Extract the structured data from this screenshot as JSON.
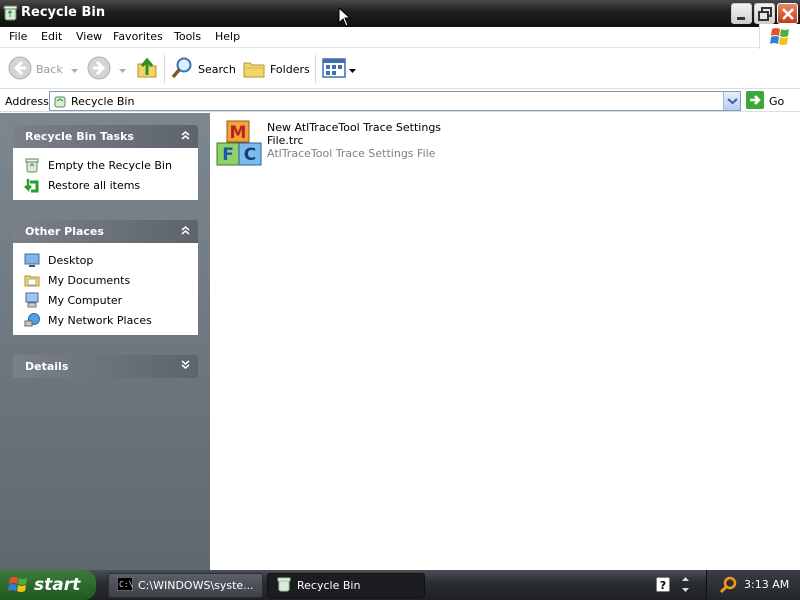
{
  "window": {
    "title": "Recycle Bin",
    "controls": {
      "minimize": "minimize",
      "maximize": "restore",
      "close": "close"
    }
  },
  "menu": [
    "File",
    "Edit",
    "View",
    "Favorites",
    "Tools",
    "Help"
  ],
  "toolbar": {
    "back_label": "Back",
    "search_label": "Search",
    "folders_label": "Folders"
  },
  "address": {
    "label": "Address",
    "value": "Recycle Bin",
    "go_label": "Go"
  },
  "tasks": {
    "recycle_bin_tasks": {
      "title": "Recycle Bin Tasks",
      "items": [
        "Empty the Recycle Bin",
        "Restore all items"
      ]
    },
    "other_places": {
      "title": "Other Places",
      "items": [
        "Desktop",
        "My Documents",
        "My Computer",
        "My Network Places"
      ]
    },
    "details": {
      "title": "Details"
    }
  },
  "files": [
    {
      "name_line1": "New AtlTraceTool Trace Settings",
      "name_line2": "File.trc",
      "type": "AtlTraceTool Trace Settings File"
    }
  ],
  "taskbar": {
    "start_label": "start",
    "buttons": [
      "C:\\WINDOWS\\syste...",
      "Recycle Bin"
    ],
    "clock": "3:13 AM"
  },
  "colors": {
    "titlebar": "#1e1e1e",
    "taskpane": "#6b747c",
    "start_button": "#2f6e2f",
    "file_type_text": "#808080"
  }
}
